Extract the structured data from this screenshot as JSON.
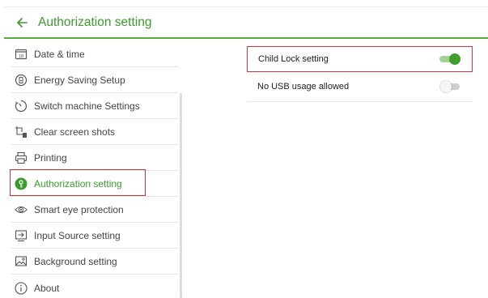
{
  "header": {
    "title": "Authorization setting",
    "back_icon": "arrow-left-icon"
  },
  "colors": {
    "accent": "#3b9b2c",
    "highlight_border": "#c9383b"
  },
  "sidebar": {
    "items": [
      {
        "label": "Date & time",
        "icon": "calendar-icon",
        "active": false
      },
      {
        "label": "Energy Saving Setup",
        "icon": "energy-icon",
        "active": false
      },
      {
        "label": "Switch machine Settings",
        "icon": "timer-icon",
        "active": false
      },
      {
        "label": "Clear screen shots",
        "icon": "crop-trash-icon",
        "active": false
      },
      {
        "label": "Printing",
        "icon": "printer-icon",
        "active": false
      },
      {
        "label": "Authorization setting",
        "icon": "key-icon",
        "active": true
      },
      {
        "label": "Smart eye protection",
        "icon": "eye-icon",
        "active": false
      },
      {
        "label": "Input Source setting",
        "icon": "input-source-icon",
        "active": false
      },
      {
        "label": "Background setting",
        "icon": "image-icon",
        "active": false
      },
      {
        "label": "About",
        "icon": "info-icon",
        "active": false
      }
    ]
  },
  "settings": [
    {
      "label": "Child Lock setting",
      "enabled": true
    },
    {
      "label": "No USB usage allowed",
      "enabled": false
    }
  ]
}
